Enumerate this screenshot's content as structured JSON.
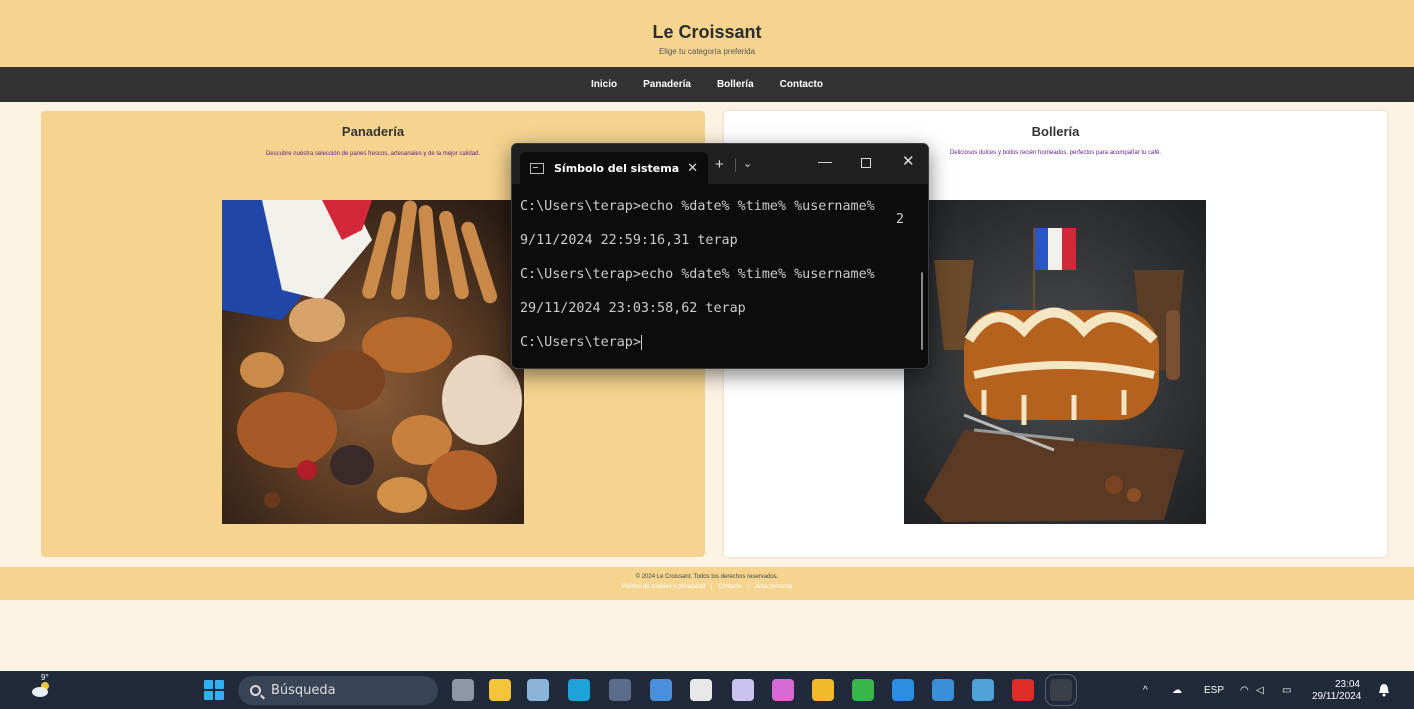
{
  "site": {
    "title": "Le Croissant",
    "subtitle": "Elige tu categoría preferida",
    "nav": [
      "Inicio",
      "Panadería",
      "Bollería",
      "Contacto"
    ]
  },
  "cards": [
    {
      "title": "Panadería",
      "description": "Descubre nuestra selección de panes frescos, artesanales y de la mejor calidad."
    },
    {
      "title": "Bollería",
      "description": "Deliciosos dulces y bollos recién horneados, perfectos para acompañar tu café."
    }
  ],
  "footer": {
    "copyright": "© 2024 Le Croissant. Todos los derechos reservados.",
    "links": [
      "Política de cookies y privacidad",
      "Contacto",
      "Área personal"
    ],
    "separator": "|"
  },
  "terminal": {
    "tab_label": "Símbolo del sistema",
    "lines": [
      "C:\\Users\\terap>echo %date% %time% %username%",
      "2",
      "9/11/2024 22:59:16,31 terap",
      "",
      "C:\\Users\\terap>echo %date% %time% %username%",
      "",
      "29/11/2024 23:03:58,62 terap",
      "",
      "C:\\Users\\terap>"
    ]
  },
  "taskbar": {
    "weather_temp": "9°",
    "search_placeholder": "Búsqueda",
    "tray": {
      "language": "ESP",
      "time": "23:04",
      "date": "29/11/2024"
    },
    "apps": [
      {
        "name": "task-view",
        "color": "#8e97a6"
      },
      {
        "name": "file-explorer",
        "color": "#f4c43a"
      },
      {
        "name": "photos",
        "color": "#8ab4d8"
      },
      {
        "name": "edge",
        "color": "#1fa2d8"
      },
      {
        "name": "app-tool",
        "color": "#5b6d8a"
      },
      {
        "name": "notepad",
        "color": "#4a8fd9"
      },
      {
        "name": "app-g",
        "color": "#e8e8e8"
      },
      {
        "name": "app-lens",
        "color": "#c9c3ee"
      },
      {
        "name": "copilot",
        "color": "#d86bd3"
      },
      {
        "name": "chrome",
        "color": "#f2b92c"
      },
      {
        "name": "xbox",
        "color": "#3ab54a"
      },
      {
        "name": "vscode",
        "color": "#2a8fe0"
      },
      {
        "name": "outlook",
        "color": "#3a8fd8"
      },
      {
        "name": "installer",
        "color": "#4fa3d8"
      },
      {
        "name": "acrobat",
        "color": "#e02d28"
      },
      {
        "name": "terminal",
        "color": "#3a3f48"
      }
    ]
  }
}
